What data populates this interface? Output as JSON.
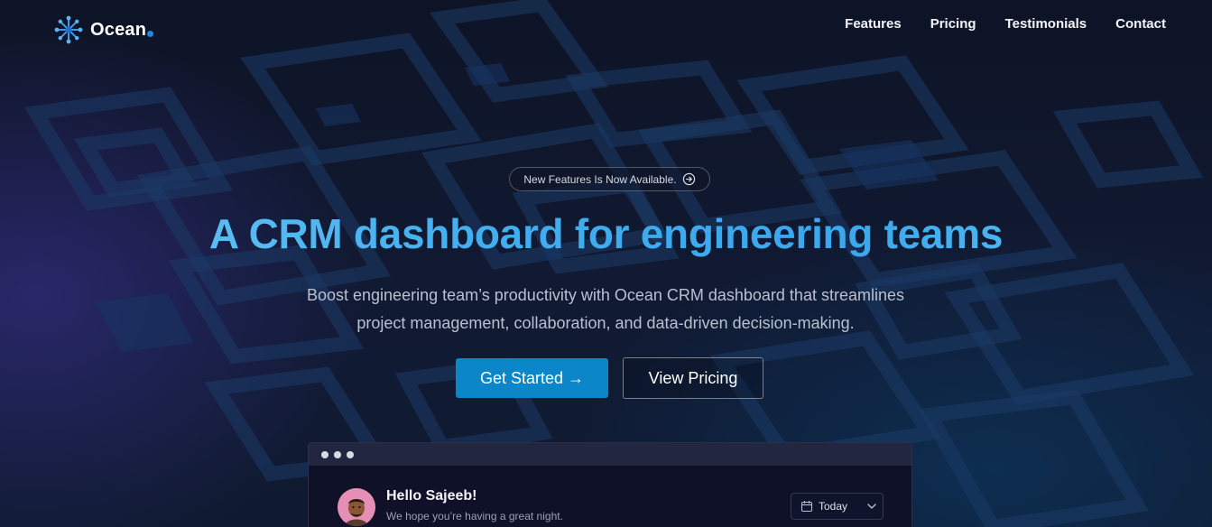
{
  "brand": {
    "name": "Ocean",
    "logo_icon": "starburst-logo-icon",
    "accent": "#1e8be0"
  },
  "nav": {
    "links": [
      {
        "label": "Features"
      },
      {
        "label": "Pricing"
      },
      {
        "label": "Testimonials"
      },
      {
        "label": "Contact"
      }
    ]
  },
  "hero": {
    "badge": {
      "text": "New Features Is Now Available.",
      "icon": "arrow-circle-right-icon"
    },
    "headline": "A CRM dashboard for engineering teams",
    "subtitle_line1": "Boost engineering team’s productivity with Ocean CRM dashboard that streamlines",
    "subtitle_line2": "project management, collaboration, and data-driven decision-making.",
    "primary_button": "Get Started →",
    "secondary_button": "View Pricing",
    "primary_color": "#0a86c9",
    "headline_gradient": [
      "#6cc8f5",
      "#3aa7ee"
    ]
  },
  "preview": {
    "greeting": "Hello Sajeeb!",
    "greeting_sub": "We hope you’re having a great night.",
    "date_filter": "Today",
    "date_icon": "calendar-icon",
    "dropdown_icon": "chevron-down-icon"
  }
}
